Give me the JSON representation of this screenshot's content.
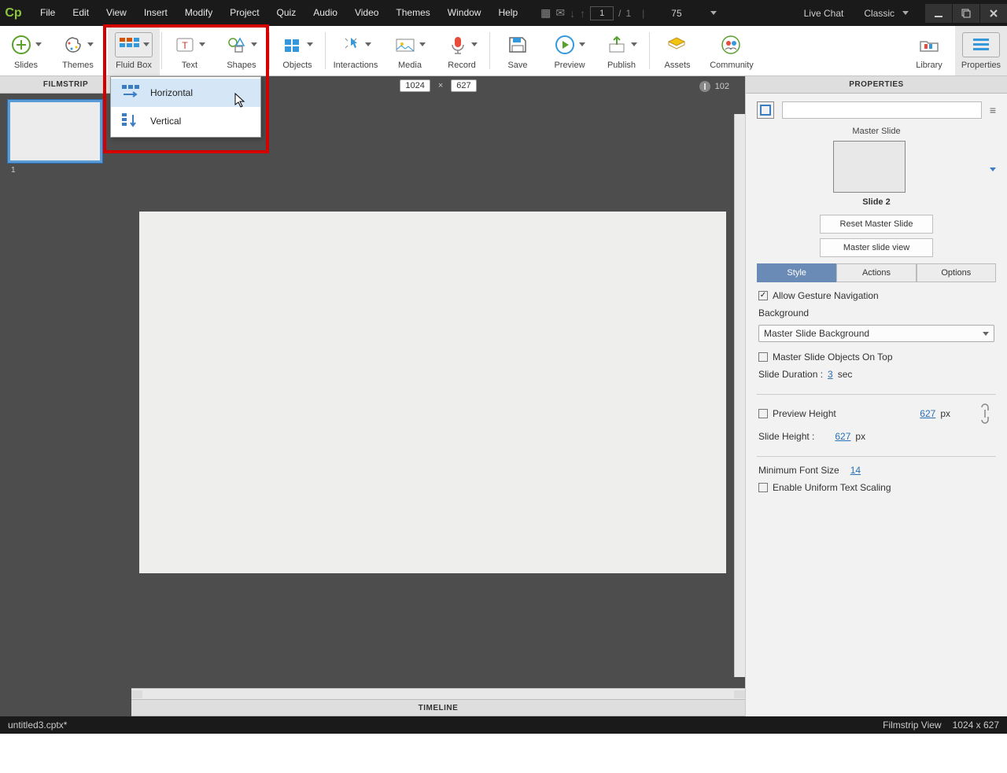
{
  "titlebar": {
    "menus": [
      "File",
      "Edit",
      "View",
      "Insert",
      "Modify",
      "Project",
      "Quiz",
      "Audio",
      "Video",
      "Themes",
      "Window",
      "Help"
    ],
    "page_current": "1",
    "page_sep": "/",
    "page_total": "1",
    "zoom": "75",
    "livechat": "Live Chat",
    "workspace": "Classic"
  },
  "toolbar": {
    "items": [
      "Slides",
      "Themes",
      "Fluid Box",
      "Text",
      "Shapes",
      "Objects",
      "Interactions",
      "Media",
      "Record",
      "Save",
      "Preview",
      "Publish",
      "Assets",
      "Community",
      "Library",
      "Properties"
    ]
  },
  "dropdown": {
    "horizontal": "Horizontal",
    "vertical": "Vertical"
  },
  "filmstrip": {
    "header": "FILMSTRIP",
    "slide1_num": "1"
  },
  "canvas": {
    "width": "1024",
    "height": "627",
    "x": "×",
    "ruler_right": "102"
  },
  "timeline": {
    "header": "TIMELINE"
  },
  "properties": {
    "header": "PROPERTIES",
    "master_slide_label": "Master Slide",
    "master_slide_name": "Slide 2",
    "reset_btn": "Reset Master Slide",
    "view_btn": "Master slide view",
    "tabs": {
      "style": "Style",
      "actions": "Actions",
      "options": "Options"
    },
    "allow_gesture": "Allow Gesture Navigation",
    "background_label": "Background",
    "background_value": "Master Slide Background",
    "objects_on_top": "Master Slide Objects On Top",
    "slide_duration_label": "Slide Duration :",
    "slide_duration_val": "3",
    "slide_duration_unit": "sec",
    "preview_height_label": "Preview Height",
    "preview_height_val": "627",
    "px": "px",
    "slide_height_label": "Slide Height :",
    "slide_height_val": "627",
    "min_font_label": "Minimum Font Size",
    "min_font_val": "14",
    "uniform_scaling": "Enable Uniform Text Scaling"
  },
  "status": {
    "filename": "untitled3.cptx*",
    "view": "Filmstrip View",
    "dims": "1024 x 627"
  }
}
